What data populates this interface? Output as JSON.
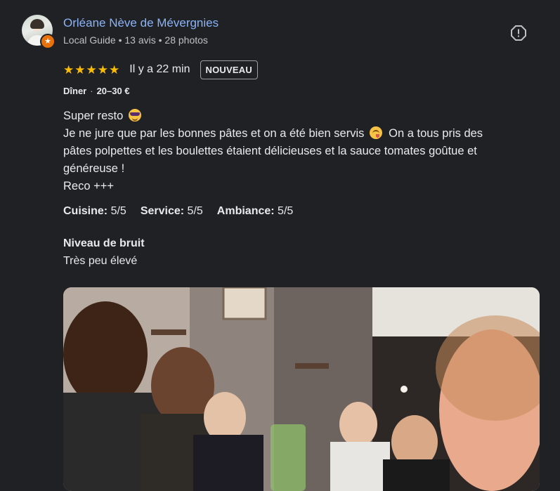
{
  "review": {
    "author": {
      "name": "Orléane Nève de Mévergnies",
      "meta": "Local Guide • 13 avis • 28 photos",
      "avatar_icon": "user-avatar",
      "badge_icon": "local-guide-star"
    },
    "flag_icon": "report-icon",
    "rating": 5,
    "time_ago": "Il y a 22 min",
    "badge": "NOUVEAU",
    "meal": {
      "type": "Dîner",
      "price": "20–30 €"
    },
    "text_lines": [
      "Super resto",
      "Je ne jure que par les bonnes pâtes et on a été bien servis",
      "On a tous pris des",
      "pâtes polpettes et les boulettes étaient délicieuses et la sauce tomates goûtue et",
      "généreuse !",
      "Reco +++"
    ],
    "sub_ratings": [
      {
        "label": "Cuisine:",
        "value": "5/5"
      },
      {
        "label": "Service:",
        "value": "5/5"
      },
      {
        "label": "Ambiance:",
        "value": "5/5"
      }
    ],
    "noise": {
      "title": "Niveau de bruit",
      "value": "Très peu élevé"
    },
    "photo_alt": "group-selfie-photo"
  },
  "colors": {
    "background": "#202124",
    "author_link": "#8ab4f8",
    "star": "#fbbc04",
    "text": "#e8eaed",
    "secondary_text": "#bdc1c6",
    "guide_badge": "#e8710a"
  }
}
